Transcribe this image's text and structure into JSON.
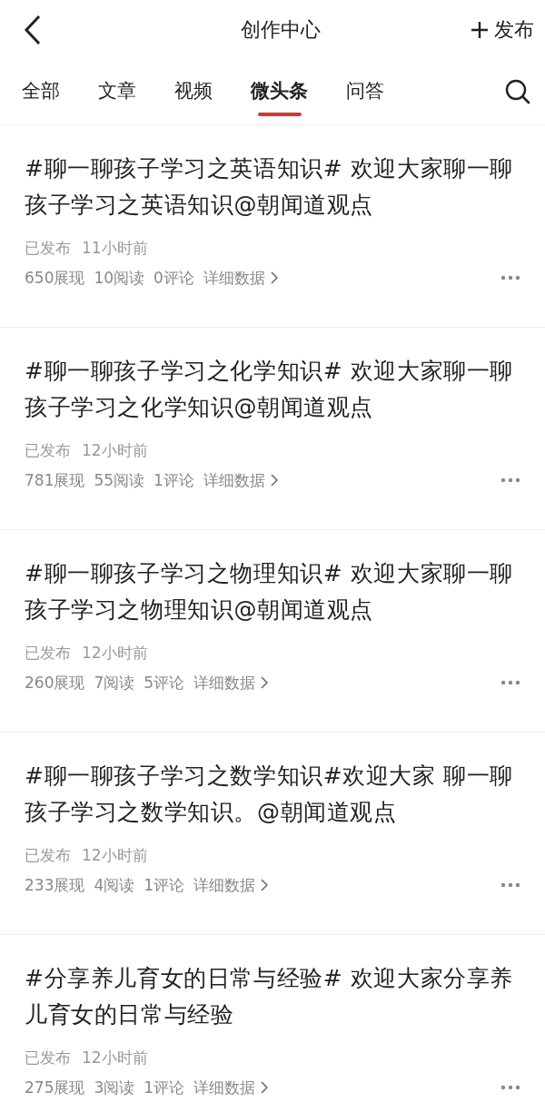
{
  "header": {
    "title": "创作中心",
    "publish_label": "发布"
  },
  "tabs": [
    {
      "label": "全部",
      "selected": false
    },
    {
      "label": "文章",
      "selected": false
    },
    {
      "label": "视频",
      "selected": false
    },
    {
      "label": "微头条",
      "selected": true
    },
    {
      "label": "问答",
      "selected": false
    }
  ],
  "posts": [
    {
      "title": "#聊一聊孩子学习之英语知识# 欢迎大家聊一聊孩子学习之英语知识@朝闻道观点",
      "status": "已发布",
      "time": "11小时前",
      "views": "650展现",
      "reads": "10阅读",
      "comments": "0评论",
      "details": "详细数据"
    },
    {
      "title": "#聊一聊孩子学习之化学知识# 欢迎大家聊一聊孩子学习之化学知识@朝闻道观点",
      "status": "已发布",
      "time": "12小时前",
      "views": "781展现",
      "reads": "55阅读",
      "comments": "1评论",
      "details": "详细数据"
    },
    {
      "title": "#聊一聊孩子学习之物理知识# 欢迎大家聊一聊孩子学习之物理知识@朝闻道观点",
      "status": "已发布",
      "time": "12小时前",
      "views": "260展现",
      "reads": "7阅读",
      "comments": "5评论",
      "details": "详细数据"
    },
    {
      "title": "#聊一聊孩子学习之数学知识#欢迎大家 聊一聊孩子学习之数学知识。@朝闻道观点",
      "status": "已发布",
      "time": "12小时前",
      "views": "233展现",
      "reads": "4阅读",
      "comments": "1评论",
      "details": "详细数据"
    },
    {
      "title": "#分享养儿育女的日常与经验# 欢迎大家分享养儿育女的日常与经验",
      "status": "已发布",
      "time": "12小时前",
      "views": "275展现",
      "reads": "3阅读",
      "comments": "1评论",
      "details": "详细数据"
    }
  ]
}
